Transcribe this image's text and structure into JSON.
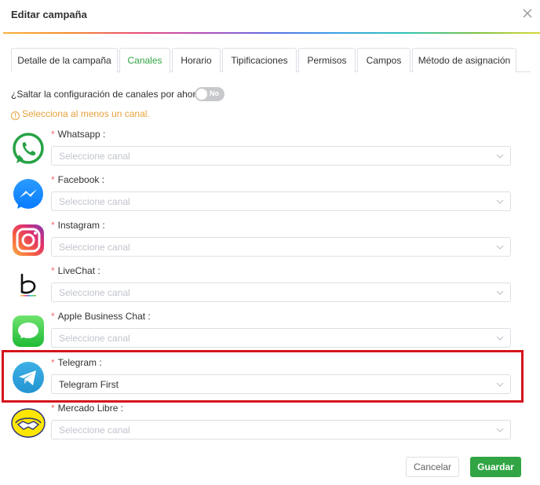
{
  "dialog": {
    "title": "Editar campaña"
  },
  "tabs": [
    {
      "label": "Detalle de la campaña",
      "active": false
    },
    {
      "label": "Canales",
      "active": true
    },
    {
      "label": "Horario",
      "active": false
    },
    {
      "label": "Tipificaciones",
      "active": false
    },
    {
      "label": "Permisos",
      "active": false
    },
    {
      "label": "Campos",
      "active": false
    },
    {
      "label": "Método de asignación",
      "active": false
    }
  ],
  "skip": {
    "label": "¿Saltar la configuración de canales por ahora?",
    "toggle_text": "No"
  },
  "warning": {
    "icon_text": "!",
    "text": "Selecciona al menos un canal."
  },
  "channels": [
    {
      "label": "Whatsapp :",
      "value": "",
      "placeholder": "Seleccione canal",
      "icon": "whatsapp-icon"
    },
    {
      "label": "Facebook :",
      "value": "",
      "placeholder": "Seleccione canal",
      "icon": "messenger-icon"
    },
    {
      "label": "Instagram :",
      "value": "",
      "placeholder": "Seleccione canal",
      "icon": "instagram-icon"
    },
    {
      "label": "LiveChat :",
      "value": "",
      "placeholder": "Seleccione canal",
      "icon": "livechat-icon"
    },
    {
      "label": "Apple Business Chat :",
      "value": "",
      "placeholder": "Seleccione canal",
      "icon": "apple-messages-icon"
    },
    {
      "label": "Telegram :",
      "value": "Telegram First",
      "placeholder": "Seleccione canal",
      "icon": "telegram-icon"
    },
    {
      "label": "Mercado Libre :",
      "value": "",
      "placeholder": "Seleccione canal",
      "icon": "mercadolibre-icon"
    }
  ],
  "required_mark": "*",
  "buttons": {
    "cancel": "Cancelar",
    "save": "Guardar"
  },
  "colors": {
    "accent": "#31a544",
    "warning": "#e6a23c",
    "required": "#f56c6c",
    "highlight": "#d4141c"
  }
}
